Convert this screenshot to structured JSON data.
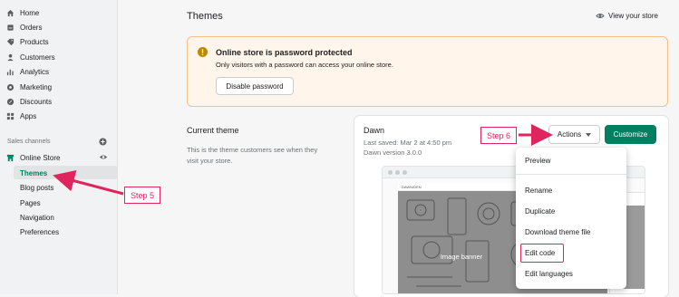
{
  "sidebar": {
    "items": [
      {
        "label": "Home",
        "icon": "home-icon"
      },
      {
        "label": "Orders",
        "icon": "orders-icon"
      },
      {
        "label": "Products",
        "icon": "products-icon"
      },
      {
        "label": "Customers",
        "icon": "customers-icon"
      },
      {
        "label": "Analytics",
        "icon": "analytics-icon"
      },
      {
        "label": "Marketing",
        "icon": "marketing-icon"
      },
      {
        "label": "Discounts",
        "icon": "discounts-icon"
      },
      {
        "label": "Apps",
        "icon": "apps-icon"
      }
    ],
    "sales_channels_label": "Sales channels",
    "online_store_label": "Online Store",
    "sub_items": [
      "Themes",
      "Blog posts",
      "Pages",
      "Navigation",
      "Preferences"
    ]
  },
  "header": {
    "title": "Themes",
    "view_store_label": "View your store"
  },
  "banner": {
    "title": "Online store is password protected",
    "text": "Only visitors with a password can access your online store.",
    "button_label": "Disable password"
  },
  "current_theme": {
    "section_title": "Current theme",
    "section_desc_line1": "This is the theme customers see when they",
    "section_desc_line2": "visit your store.",
    "name": "Dawn",
    "last_saved": "Last saved: Mar 2 at 4:50 pm",
    "version": "Dawn version 3.0.0",
    "actions_label": "Actions",
    "customize_label": "Customize",
    "preview_banner_label": "Image banner",
    "preview_logo": "DAWN/DEN"
  },
  "actions_menu": [
    "Preview",
    "Rename",
    "Duplicate",
    "Download theme file",
    "Edit code",
    "Edit languages"
  ],
  "annotations": {
    "step5": "Step 5",
    "step6": "Step 6"
  },
  "colors": {
    "accent_green": "#008060",
    "annotation_pink": "#e0245e",
    "warning_bg": "#fff5ea"
  }
}
